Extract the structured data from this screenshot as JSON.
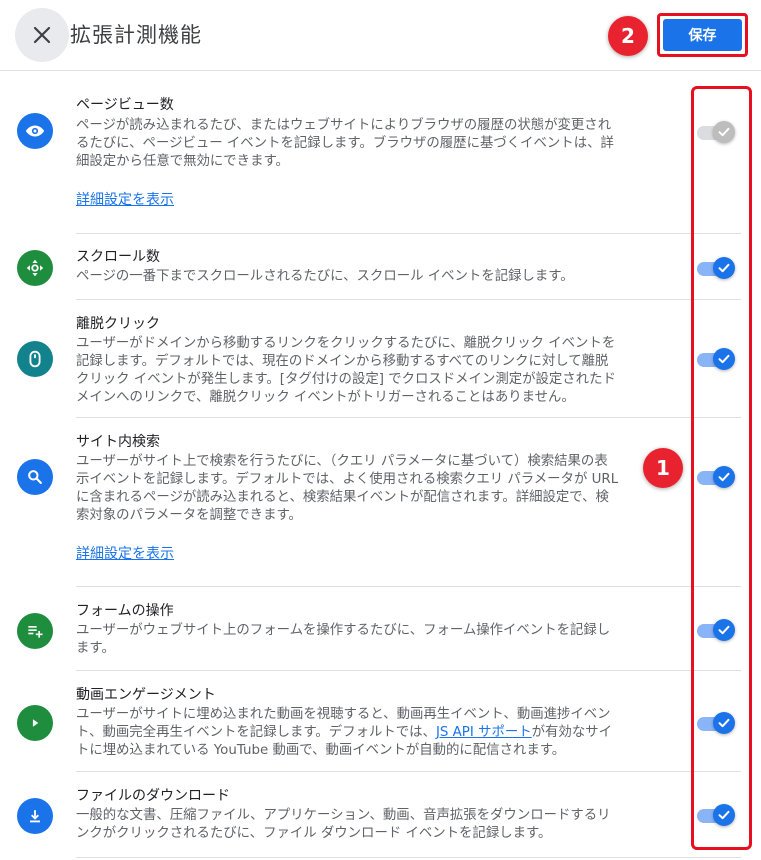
{
  "header": {
    "title": "拡張計測機能",
    "save_label": "保存",
    "badge_save": "2"
  },
  "annotations": {
    "badge_toggles": "1"
  },
  "colors": {
    "accent": "#1a73e8",
    "highlight": "#e8101f",
    "icon_blue": "#1a73e8",
    "icon_green": "#1e8e3e",
    "icon_teal": "#12838c"
  },
  "rows": [
    {
      "title": "ページビュー数",
      "icon": "eye-icon",
      "desc_lines": [
        "ページが読み込まれるたび、またはウェブサイトによりブラウザの履歴の状態が変更され",
        "るたびに、ページビュー イベントを記録します。ブラウザの履歴に基づくイベントは、詳",
        "細設定から任意で無効にできます。"
      ],
      "link": "詳細設定を表示",
      "enabled": false
    },
    {
      "title": "スクロール数",
      "icon": "scroll-crosshair-icon",
      "desc_lines": [
        "ページの一番下までスクロールされるたびに、スクロール イベントを記録します。"
      ],
      "enabled": true
    },
    {
      "title": "離脱クリック",
      "icon": "mouse-icon",
      "desc_lines": [
        "ユーザーがドメインから移動するリンクをクリックするたびに、離脱クリック イベントを",
        "記録します。デフォルトでは、現在のドメインから移動するすべてのリンクに対して離脱",
        "クリック イベントが発生します。[タグ付けの設定] でクロスドメイン測定が設定されたド",
        "メインへのリンクで、離脱クリック イベントがトリガーされることはありません。"
      ],
      "enabled": true
    },
    {
      "title": "サイト内検索",
      "icon": "search-icon",
      "desc_lines": [
        "ユーザーがサイト上で検索を行うたびに、（クエリ パラメータに基づいて）検索結果の表",
        "示イベントを記録します。デフォルトでは、よく使用される検索クエリ パラメータが URL",
        "に含まれるページが読み込まれると、検索結果イベントが配信されます。詳細設定で、検",
        "索対象のパラメータを調整できます。"
      ],
      "link": "詳細設定を表示",
      "enabled": true
    },
    {
      "title": "フォームの操作",
      "icon": "form-add-icon",
      "desc_lines": [
        "ユーザーがウェブサイト上のフォームを操作するたびに、フォーム操作イベントを記録し",
        "ます。"
      ],
      "enabled": true
    },
    {
      "title": "動画エンゲージメント",
      "icon": "play-icon",
      "desc_lines": [
        "ユーザーがサイトに埋め込まれた動画を視聴すると、動画再生イベント、動画進捗イベン",
        "ト、動画完全再生イベントを記録します。デフォルトでは、"
      ],
      "desc_link": "JS API サポート",
      "desc_after_link": "が有効なサイ",
      "desc_tail": "トに埋め込まれている YouTube 動画で、動画イベントが自動的に配信されます。",
      "enabled": true
    },
    {
      "title": "ファイルのダウンロード",
      "icon": "download-icon",
      "desc_lines": [
        "一般的な文書、圧縮ファイル、アプリケーション、動画、音声拡張をダウンロードするリ",
        "ンクがクリックされるたびに、ファイル ダウンロード イベントを記録します。"
      ],
      "enabled": true
    }
  ]
}
